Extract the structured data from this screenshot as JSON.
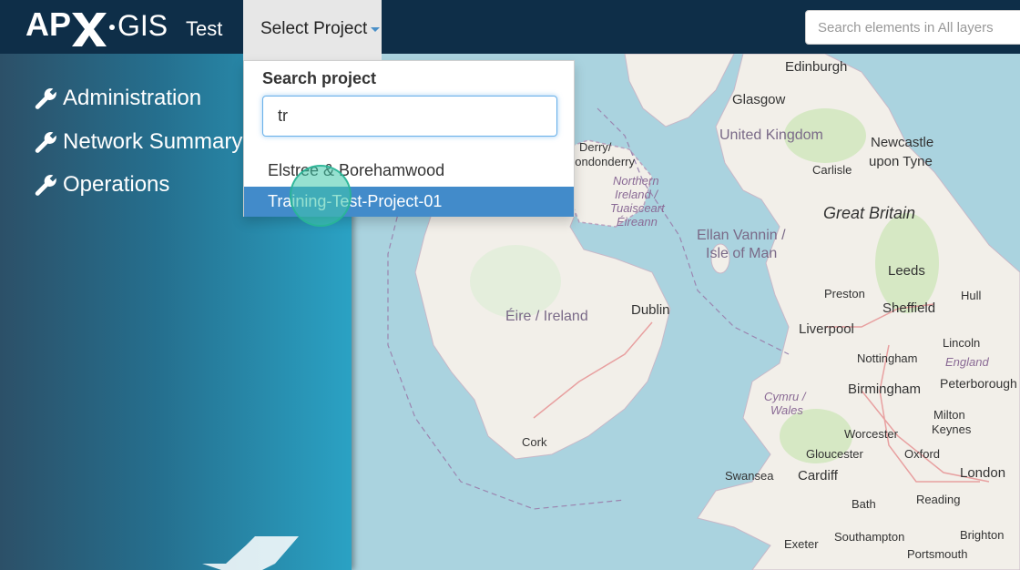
{
  "navbar": {
    "logo_text": "APX·GIS",
    "env_label": "Test",
    "project_toggle_label": "Select Project",
    "search_placeholder": "Search elements in All layers"
  },
  "sidebar": {
    "items": [
      {
        "label": "Administration",
        "icon": "wrench-icon"
      },
      {
        "label": "Network Summary",
        "icon": "wrench-icon"
      },
      {
        "label": "Operations",
        "icon": "wrench-icon"
      }
    ]
  },
  "dropdown": {
    "heading": "Search project",
    "search_value": "tr",
    "results": [
      {
        "label": "Elstree & Borehamwood",
        "active": false
      },
      {
        "label": "Training-Test-Project-01",
        "active": true
      }
    ]
  },
  "map": {
    "labels": [
      {
        "text": "Edinburgh"
      },
      {
        "text": "Glasgow"
      },
      {
        "text": "United Kingdom"
      },
      {
        "text": "Newcastle"
      },
      {
        "text": "upon Tyne"
      },
      {
        "text": "Carlisle"
      },
      {
        "text": "Derry/"
      },
      {
        "text": "Londonderry"
      },
      {
        "text": "Northern"
      },
      {
        "text": "Ireland /"
      },
      {
        "text": "Tuaisceart"
      },
      {
        "text": "Éireann"
      },
      {
        "text": "Great Britain"
      },
      {
        "text": "Ellan Vannin /"
      },
      {
        "text": "Isle of Man"
      },
      {
        "text": "Leeds"
      },
      {
        "text": "Preston"
      },
      {
        "text": "Hull"
      },
      {
        "text": "Sheffield"
      },
      {
        "text": "Éire / Ireland"
      },
      {
        "text": "Dublin"
      },
      {
        "text": "Liverpool"
      },
      {
        "text": "Lincoln"
      },
      {
        "text": "Nottingham"
      },
      {
        "text": "England"
      },
      {
        "text": "Birmingham"
      },
      {
        "text": "Peterborough"
      },
      {
        "text": "Cymru /"
      },
      {
        "text": "Wales"
      },
      {
        "text": "Milton"
      },
      {
        "text": "Keynes"
      },
      {
        "text": "Worcester"
      },
      {
        "text": "Cork"
      },
      {
        "text": "Gloucester"
      },
      {
        "text": "Oxford"
      },
      {
        "text": "Swansea"
      },
      {
        "text": "Cardiff"
      },
      {
        "text": "London"
      },
      {
        "text": "Bath"
      },
      {
        "text": "Reading"
      },
      {
        "text": "Exeter"
      },
      {
        "text": "Southampton"
      },
      {
        "text": "Brighton"
      },
      {
        "text": "Portsmouth"
      }
    ]
  },
  "colors": {
    "navbar": "#0e2e48",
    "sea": "#aad3df",
    "land": "#f2efe9",
    "active_item": "#428bca"
  }
}
